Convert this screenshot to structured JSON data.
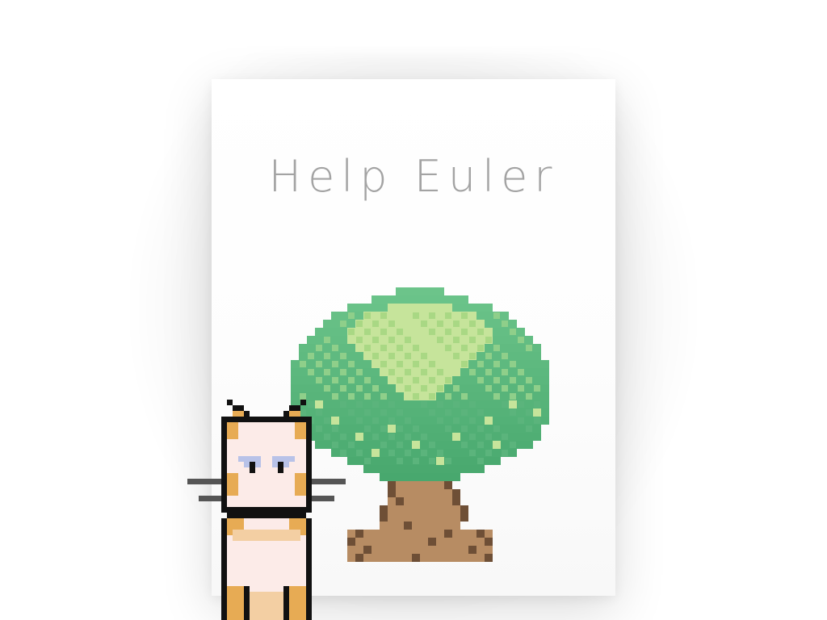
{
  "title": "Help Euler",
  "sprites": {
    "tree": "tree-icon",
    "cat": "cat-icon"
  },
  "colors": {
    "background": "#ffffff",
    "card": "#ffffff",
    "title": "#a3a3a3",
    "leaf_dark": "#4aa86e",
    "leaf_mid": "#6cc48a",
    "leaf_light": "#c6e49b",
    "trunk": "#b78c63",
    "trunk_dark": "#6e4f36",
    "cat_fur": "#fcebe8",
    "cat_orange": "#e7ab54",
    "cat_outline": "#111111",
    "cat_eye": "#b8c2e8"
  }
}
